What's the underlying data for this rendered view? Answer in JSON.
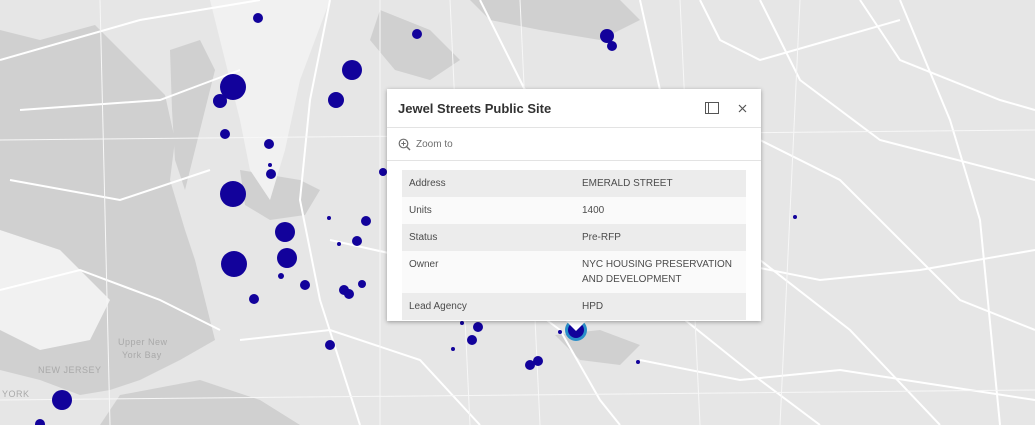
{
  "map": {
    "place_labels": [
      "Upper New",
      "York Bay",
      "NEW JERSEY",
      "YORK"
    ],
    "marker_color": "#12029b",
    "selected_color": "#2a8fc9",
    "basemap_color": "#e6e6e6"
  },
  "popup": {
    "title": "Jewel Streets Public Site",
    "dock_icon": "dock-icon",
    "close_icon": "close-icon",
    "zoom_icon": "zoom-in-icon",
    "zoom_label": "Zoom to",
    "fields": [
      {
        "key": "Address",
        "value": "EMERALD STREET"
      },
      {
        "key": "Units",
        "value": "1400"
      },
      {
        "key": "Status",
        "value": "Pre-RFP"
      },
      {
        "key": "Owner",
        "value": "NYC HOUSING PRESERVATION AND DEVELOPMENT"
      },
      {
        "key": "Lead Agency",
        "value": "HPD"
      }
    ]
  }
}
